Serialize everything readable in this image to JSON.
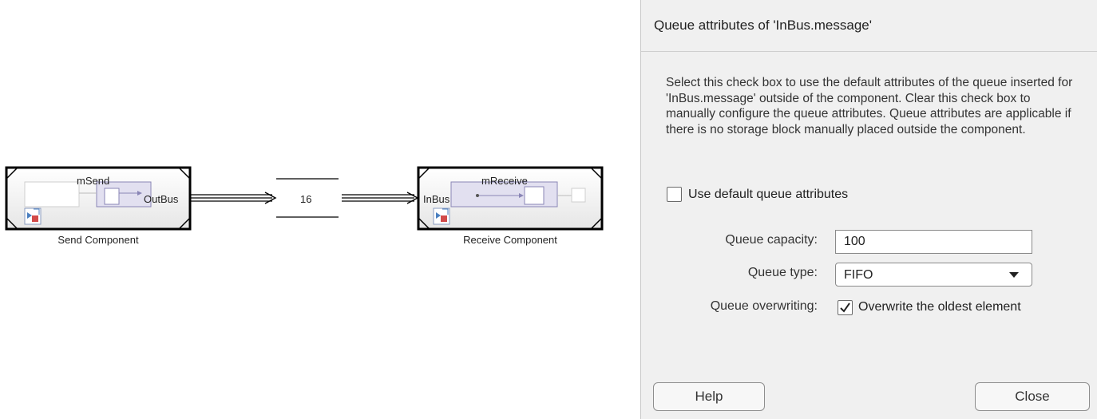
{
  "canvas": {
    "send_block": {
      "inner_name": "mSend",
      "port_label": "OutBus",
      "caption": "Send Component"
    },
    "queue_signal": {
      "value": "16"
    },
    "receive_block": {
      "inner_name": "mReceive",
      "port_label": "InBus",
      "caption": "Receive Component"
    }
  },
  "dialog": {
    "title": "Queue attributes of 'InBus.message'",
    "description": "Select this check box to use the default attributes of the queue inserted for 'InBus.message' outside of the component. Clear this check box to manually configure the queue attributes. Queue attributes are applicable if there is no storage block manually placed outside the component.",
    "default_checkbox": {
      "label": "Use default queue attributes",
      "checked": false
    },
    "capacity": {
      "label": "Queue capacity:",
      "value": "100"
    },
    "type": {
      "label": "Queue type:",
      "value": "FIFO"
    },
    "overwriting": {
      "label": "Queue overwriting:",
      "checkbox_label": "Overwrite the oldest element",
      "checked": true
    },
    "help_button": "Help",
    "close_button": "Close"
  }
}
